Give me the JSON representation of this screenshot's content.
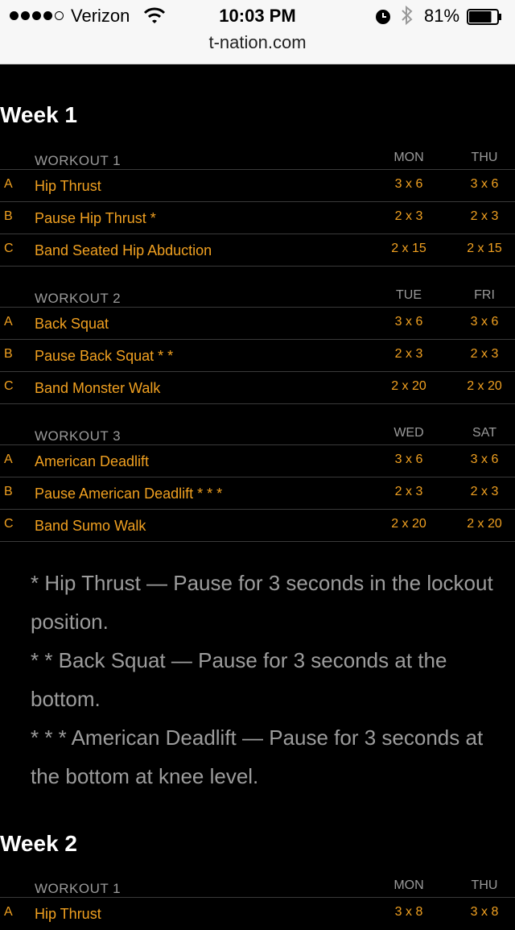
{
  "status_bar": {
    "carrier": "Verizon",
    "time": "10:03 PM",
    "battery_pct": "81%",
    "battery_level": 0.81,
    "icons": [
      "signal-dots",
      "wifi-icon",
      "alarm-icon",
      "bluetooth-icon",
      "battery-icon"
    ]
  },
  "url_bar": {
    "url": "t-nation.com"
  },
  "week1": {
    "title": "Week 1",
    "workouts": [
      {
        "name": "WORKOUT 1",
        "day1": "MON",
        "day2": "THU",
        "exercises": [
          {
            "letter": "A",
            "name": "Hip Thrust",
            "v1": "3 x 6",
            "v2": "3 x 6"
          },
          {
            "letter": "B",
            "name": "Pause Hip Thrust *",
            "v1": "2 x 3",
            "v2": "2 x 3"
          },
          {
            "letter": "C",
            "name": "Band Seated Hip Abduction",
            "v1": "2 x 15",
            "v2": "2 x 15"
          }
        ]
      },
      {
        "name": "WORKOUT 2",
        "day1": "TUE",
        "day2": "FRI",
        "exercises": [
          {
            "letter": "A",
            "name": "Back Squat",
            "v1": "3 x 6",
            "v2": "3 x 6"
          },
          {
            "letter": "B",
            "name": "Pause Back Squat * *",
            "v1": "2 x 3",
            "v2": "2 x 3"
          },
          {
            "letter": "C",
            "name": "Band Monster Walk",
            "v1": "2 x 20",
            "v2": "2 x 20"
          }
        ]
      },
      {
        "name": "WORKOUT 3",
        "day1": "WED",
        "day2": "SAT",
        "exercises": [
          {
            "letter": "A",
            "name": "American Deadlift",
            "v1": "3 x 6",
            "v2": "3 x 6"
          },
          {
            "letter": "B",
            "name": "Pause American Deadlift * * *",
            "v1": "2 x 3",
            "v2": "2 x 3"
          },
          {
            "letter": "C",
            "name": "Band Sumo Walk",
            "v1": "2 x 20",
            "v2": "2 x 20"
          }
        ]
      }
    ]
  },
  "notes": [
    "* Hip Thrust — Pause for 3 seconds in the lockout position.",
    "* * Back Squat — Pause for 3 seconds at the bottom.",
    "* * * American Deadlift — Pause for 3 seconds at the bottom at knee level."
  ],
  "week2": {
    "title": "Week 2",
    "workouts": [
      {
        "name": "WORKOUT 1",
        "day1": "MON",
        "day2": "THU",
        "exercises": [
          {
            "letter": "A",
            "name": "Hip Thrust",
            "v1": "3 x 8",
            "v2": "3 x 8"
          }
        ]
      }
    ]
  },
  "colors": {
    "accent": "#f0a020",
    "header_text": "#9a9a9a",
    "background": "#000000",
    "rule": "#3a3a3a"
  }
}
